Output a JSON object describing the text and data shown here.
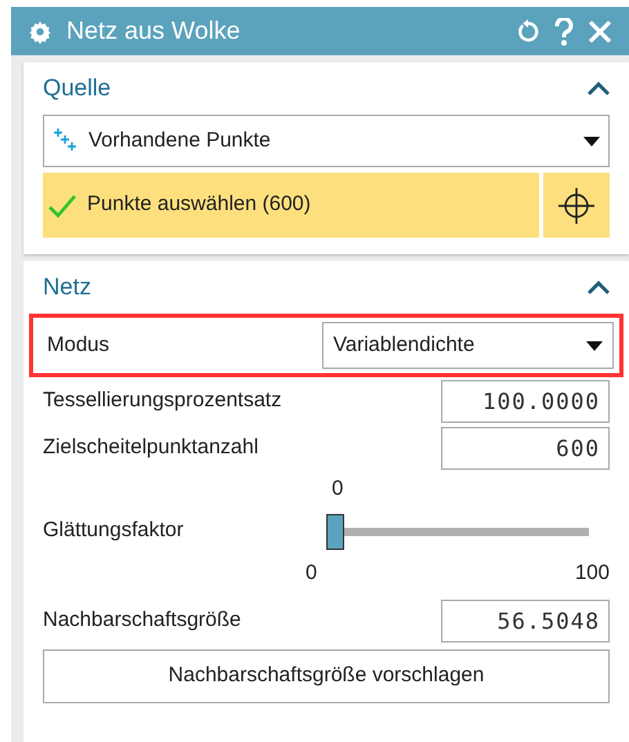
{
  "window": {
    "title": "Netz aus Wolke"
  },
  "sections": [
    {
      "title": "Quelle",
      "expanded": true
    },
    {
      "title": "Netz",
      "expanded": true
    }
  ],
  "source": {
    "dropdown": "Vorhandene Punkte",
    "selection": {
      "label": "Punkte auswählen (600)",
      "done": true
    }
  },
  "mesh": {
    "mode": {
      "label": "Modus",
      "value": "Variablendichte",
      "highlighted": true
    },
    "fields": [
      {
        "label": "Tessellierungsprozentsatz",
        "value": "100.0000"
      },
      {
        "label": "Zielscheitelpunktanzahl",
        "value": "600"
      }
    ],
    "slider": {
      "label": "Glättungsfaktor",
      "reading": "0",
      "min": "0",
      "max": "100",
      "level": 0
    },
    "neighbourhood": {
      "label": "Nachbarschaftsgröße",
      "value": "56.5048"
    },
    "button": "Nachbarschaftsgröße vorschlagen"
  }
}
